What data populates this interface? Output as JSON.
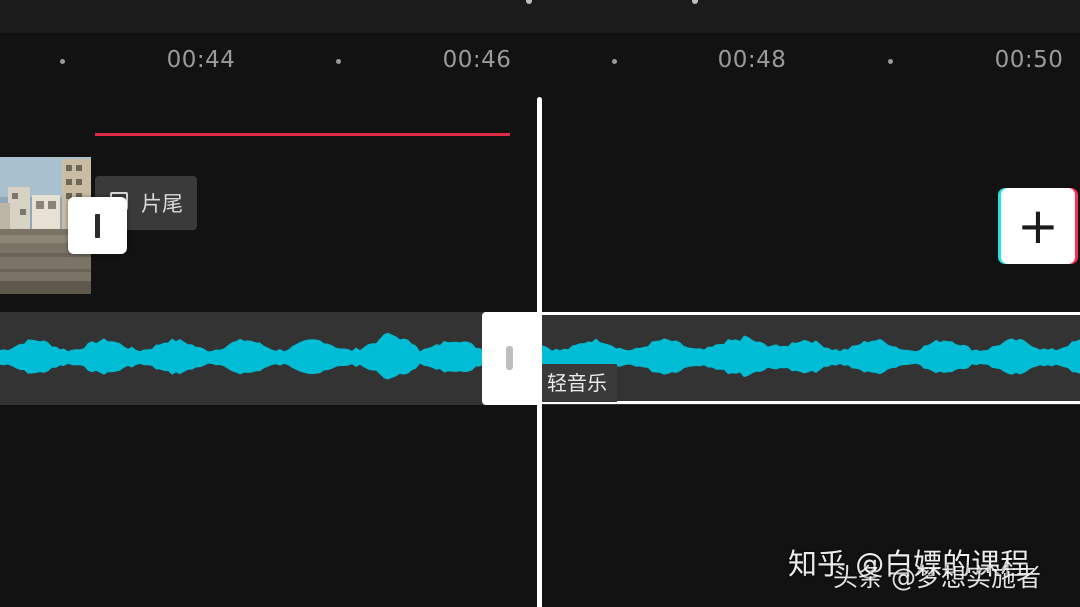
{
  "timeline": {
    "ticks": [
      "00:44",
      "00:46",
      "00:48",
      "00:50"
    ],
    "playhead_time_position_s": 46.5
  },
  "video_track": {
    "end_tag_label": "片尾",
    "end_tag_icon": "end-clip-icon",
    "transition_icon": "transition-icon",
    "add_clip_icon": "plus-icon",
    "accent_colors": {
      "red": "#e02a46",
      "cyan": "#1fe3e8",
      "pink": "#ff2c54"
    }
  },
  "audio_track": {
    "label": "轻音乐",
    "waveform_color": "#00bcd4",
    "handle_icon": "trim-handle-icon"
  },
  "watermarks": {
    "zhihu": "知乎 @白嫖的课程",
    "toutiao": "头条 @梦想实施者"
  }
}
